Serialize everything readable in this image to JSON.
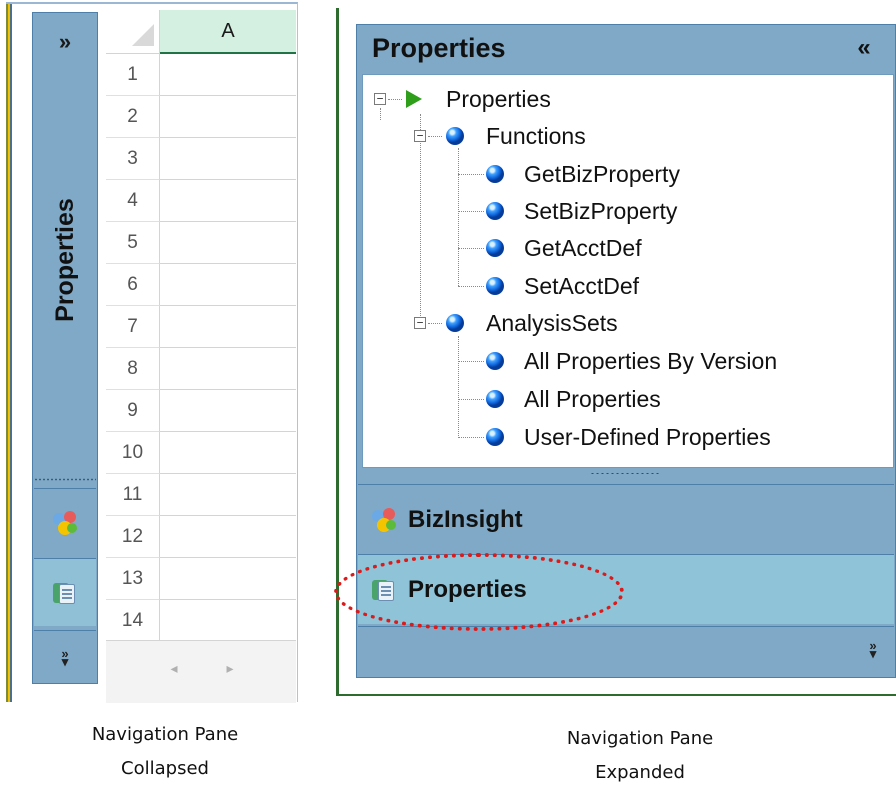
{
  "collapsed_pane": {
    "expand_glyph": "»",
    "title": "Properties",
    "more_glyph_top": "»",
    "more_glyph_bottom": "▾"
  },
  "spreadsheet": {
    "column_header": "A",
    "rows": [
      "1",
      "2",
      "3",
      "4",
      "5",
      "6",
      "7",
      "8",
      "9",
      "10",
      "11",
      "12",
      "13",
      "14"
    ],
    "scroll_left": "◂",
    "scroll_right": "▸"
  },
  "expanded_pane": {
    "title": "Properties",
    "collapse_glyph": "«",
    "tree": {
      "root": {
        "label": "Properties",
        "toggle": "⊟"
      },
      "groups": [
        {
          "label": "Functions",
          "toggle": "⊟",
          "items": [
            "GetBizProperty",
            "SetBizProperty",
            "GetAcctDef",
            "SetAcctDef"
          ]
        },
        {
          "label": "AnalysisSets",
          "toggle": "⊟",
          "items": [
            "All Properties By Version",
            "All Properties",
            "User-Defined Properties"
          ]
        }
      ]
    },
    "buttons": {
      "bizinsight": "BizInsight",
      "properties": "Properties"
    },
    "more_glyph_top": "»",
    "more_glyph_bottom": "▾",
    "highlight_color": "#dd1a1a"
  },
  "captions": {
    "left_line1": "Navigation Pane",
    "left_line2": "Collapsed",
    "right_line1": "Navigation Pane",
    "right_line2": "Expanded"
  },
  "icons": {
    "node_root": "green-play-icon",
    "node_group": "blue-ball-icon",
    "node_item": "blue-ball-icon",
    "bizinsight": "bizinsight-icon",
    "properties": "properties-icon"
  },
  "colors": {
    "pane_blue": "#7fa9c6",
    "pane_selected": "#8fc3d8",
    "excel_header_green": "#217346"
  }
}
